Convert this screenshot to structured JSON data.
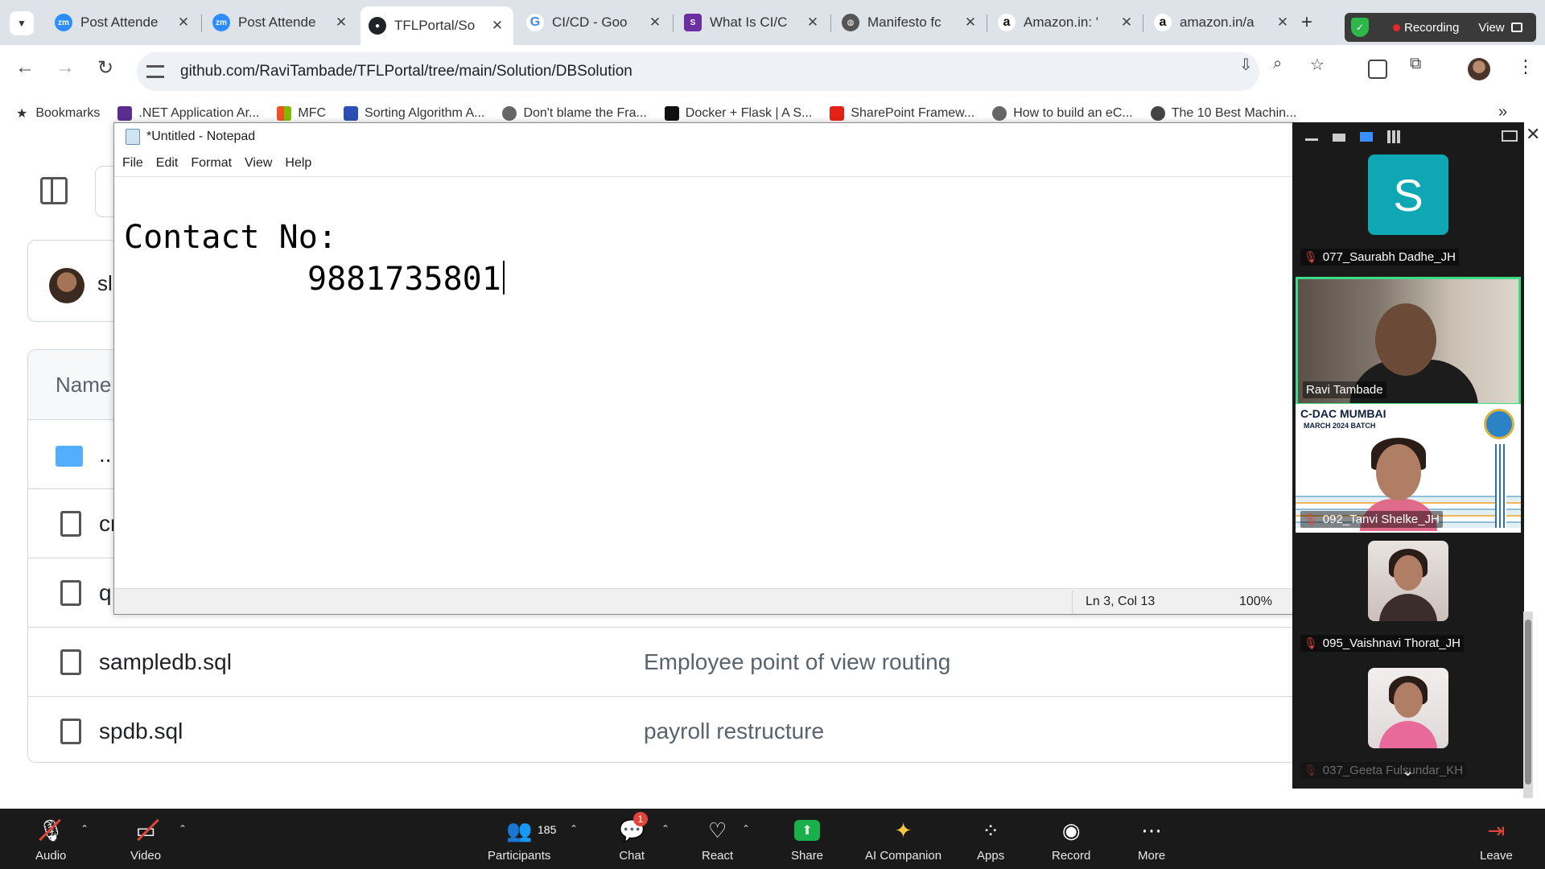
{
  "browser": {
    "tabs": [
      {
        "title": "Post Attende",
        "favicon": "zoom-icon",
        "color": "#2d8cff"
      },
      {
        "title": "Post Attende",
        "favicon": "zoom-icon",
        "color": "#2d8cff"
      },
      {
        "title": "TFLPortal/So",
        "favicon": "github-icon",
        "color": "#1f2328"
      },
      {
        "title": "CI/CD - Goo",
        "favicon": "google-icon",
        "color": "#4285f4"
      },
      {
        "title": "What Is CI/C",
        "favicon": "site-icon",
        "color": "#6b2fa0"
      },
      {
        "title": "Manifesto fc",
        "favicon": "globe-icon",
        "color": "#555555"
      },
      {
        "title": "Amazon.in: '",
        "favicon": "amazon-icon",
        "color": "#111111"
      },
      {
        "title": "amazon.in/a",
        "favicon": "amazon-icon",
        "color": "#111111"
      }
    ],
    "url": "github.com/RaviTambade/TFLPortal/tree/main/Solution/DBSolution",
    "bookmarks": [
      {
        "label": "Bookmarks",
        "icon": "star-icon"
      },
      {
        "label": ".NET Application Ar...",
        "icon": "dotnet-icon"
      },
      {
        "label": "MFC",
        "icon": "microsoft-icon"
      },
      {
        "label": "Sorting Algorithm A...",
        "icon": "site-icon"
      },
      {
        "label": "Don't blame the Fra...",
        "icon": "globe-icon"
      },
      {
        "label": "Docker + Flask | A S...",
        "icon": "site-icon"
      },
      {
        "label": "SharePoint Framew...",
        "icon": "youtube-icon"
      },
      {
        "label": "How to build an eC...",
        "icon": "globe-icon"
      },
      {
        "label": "The 10 Best Machin...",
        "icon": "globe-icon"
      }
    ]
  },
  "zoom_status": {
    "recording_label": "Recording",
    "view_label": "View"
  },
  "github": {
    "author_initials": "sl",
    "header_label": "Name",
    "rows": [
      {
        "name": "..",
        "message": ""
      },
      {
        "name": "cr",
        "message": ""
      },
      {
        "name": "q",
        "message": ""
      },
      {
        "name": "sampledb.sql",
        "message": "Employee point of view routing"
      },
      {
        "name": "spdb.sql",
        "message": "payroll restructure"
      }
    ]
  },
  "notepad": {
    "title": "*Untitled - Notepad",
    "menu": [
      "File",
      "Edit",
      "Format",
      "View",
      "Help"
    ],
    "line1": "Contact No:",
    "line2": "9881735801",
    "status_position": "Ln 3, Col 13",
    "status_zoom": "100%"
  },
  "participants": [
    {
      "name": "077_Saurabh Dadhe_JH",
      "initial": "S",
      "muted": true,
      "type": "avatar"
    },
    {
      "name": "Ravi Tambade",
      "muted": false,
      "type": "video"
    },
    {
      "name": "092_Tanvi Shelke_JH",
      "muted": true,
      "type": "cdac",
      "banner_title": "C-DAC MUMBAI",
      "banner_sub": "MARCH 2024 BATCH"
    },
    {
      "name": "095_Vaishnavi Thorat_JH",
      "muted": true,
      "type": "photo"
    },
    {
      "name": "037_Geeta Fulsundar_KH",
      "muted": true,
      "type": "photo"
    }
  ],
  "toolbar": {
    "audio": "Audio",
    "video": "Video",
    "participants": "Participants",
    "participant_count": "185",
    "chat": "Chat",
    "chat_badge": "1",
    "react": "React",
    "share": "Share",
    "ai_companion": "AI Companion",
    "apps": "Apps",
    "record": "Record",
    "more": "More",
    "leave": "Leave"
  }
}
